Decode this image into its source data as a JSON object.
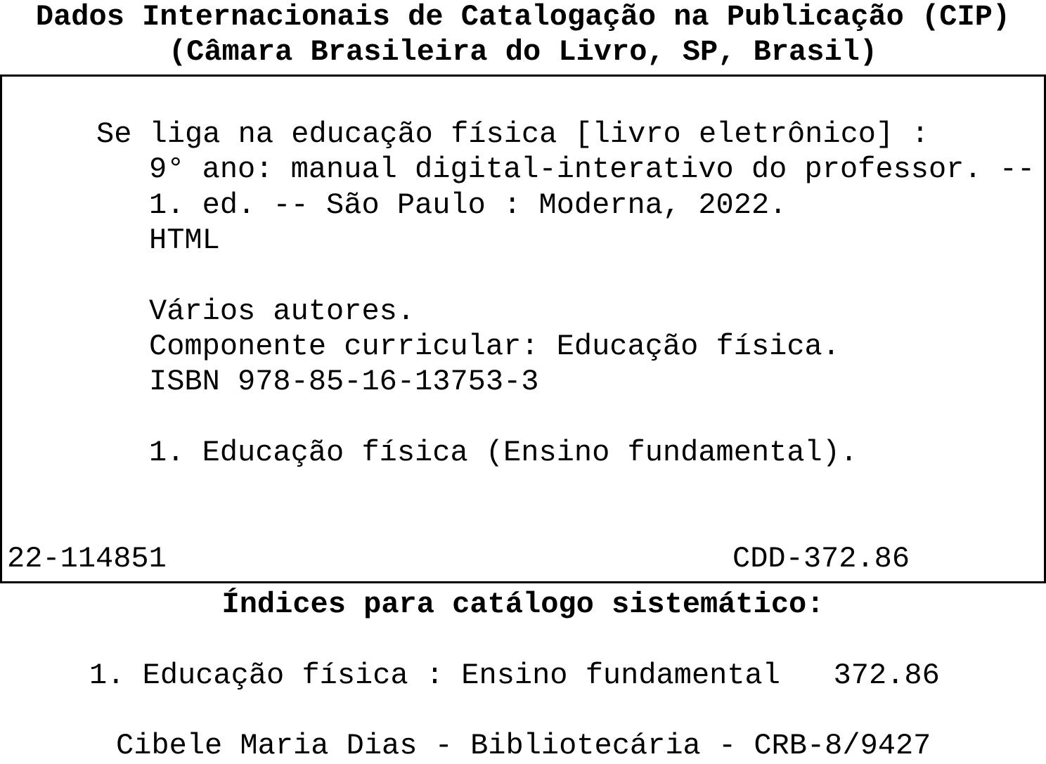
{
  "header": {
    "title": "Dados Internacionais de Catalogação na Publicação (CIP)",
    "subtitle": "(Câmara Brasileira do Livro, SP, Brasil)"
  },
  "record": {
    "title_line": "Se liga na educação física [livro eletrônico] :",
    "continuation_lines": [
      "9° ano: manual digital-interativo do professor. --",
      "1. ed. -- São Paulo : Moderna, 2022.",
      "HTML"
    ],
    "notes": [
      "Vários autores.",
      "Componente curricular: Educação física.",
      "ISBN 978-85-16-13753-3"
    ],
    "subjects": [
      "1. Educação física (Ensino fundamental)."
    ],
    "control_number": "22-114851",
    "classification": "CDD-372.86"
  },
  "indices": {
    "title": "Índices para catálogo sistemático:",
    "entries": [
      "1. Educação física : Ensino fundamental   372.86"
    ]
  },
  "librarian": "Cibele Maria Dias - Bibliotecária - CRB-8/9427"
}
